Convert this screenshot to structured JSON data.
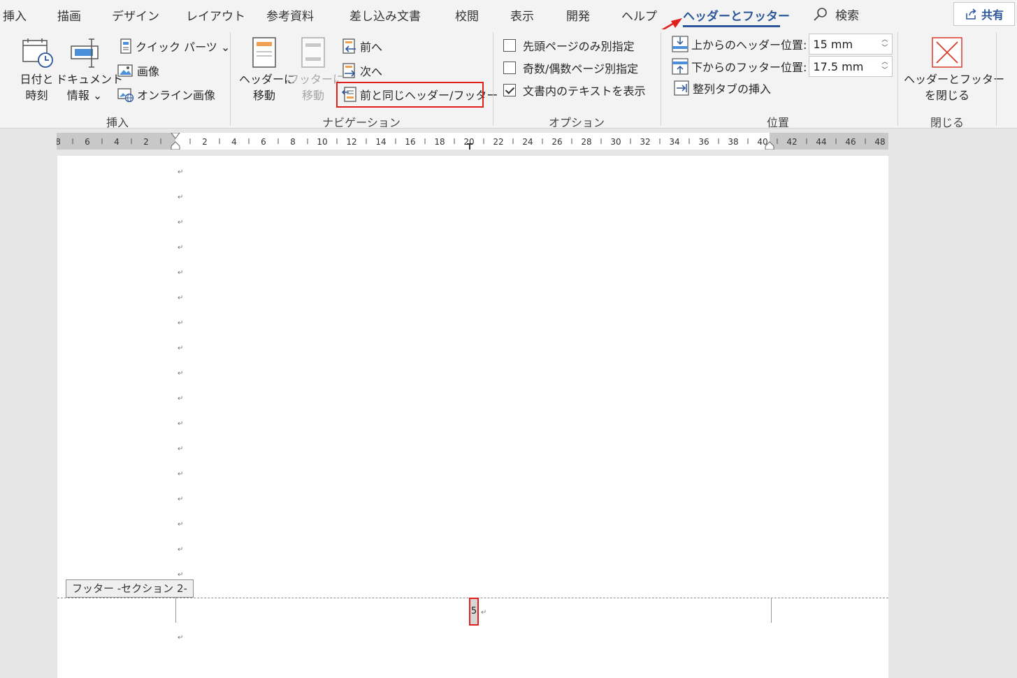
{
  "tabs": {
    "insert": "挿入",
    "draw": "描画",
    "design": "デザイン",
    "layout": "レイアウト",
    "references": "参考資料",
    "mailings": "差し込み文書",
    "review": "校閲",
    "view": "表示",
    "developer": "開発",
    "help": "ヘルプ",
    "header_footer": "ヘッダーとフッター",
    "search": "検索",
    "share": "共有"
  },
  "ribbon": {
    "insert_group": {
      "label": "挿入",
      "date_time_1": "日付と",
      "date_time_2": "時刻",
      "doc_info_1": "ドキュメント",
      "doc_info_2": "情報 ⌄",
      "quick_parts": "クイック パーツ ⌄",
      "image": "画像",
      "online_image": "オンライン画像"
    },
    "navigation_group": {
      "label": "ナビゲーション",
      "goto_header_1": "ヘッダーに",
      "goto_header_2": "移動",
      "goto_footer_1": "フッターに",
      "goto_footer_2": "移動",
      "previous": "前へ",
      "next": "次へ",
      "link_previous": "前と同じヘッダー/フッター"
    },
    "options_group": {
      "label": "オプション",
      "first_page": "先頭ページのみ別指定",
      "odd_even": "奇数/偶数ページ別指定",
      "show_doc_text": "文書内のテキストを表示",
      "first_page_checked": false,
      "odd_even_checked": false,
      "show_doc_text_checked": true
    },
    "position_group": {
      "label": "位置",
      "header_from_top": "上からのヘッダー位置:",
      "header_from_top_value": "15 mm",
      "footer_from_bottom": "下からのフッター位置:",
      "footer_from_bottom_value": "17.5 mm",
      "insert_alignment_tab": "整列タブの挿入"
    },
    "close_group": {
      "label": "閉じる",
      "close_1": "ヘッダーとフッター",
      "close_2": "を閉じる"
    }
  },
  "ruler": {
    "labels": [
      "8",
      "6",
      "4",
      "2",
      "2",
      "4",
      "6",
      "8",
      "10",
      "12",
      "14",
      "16",
      "18",
      "20",
      "22",
      "24",
      "26",
      "28",
      "30",
      "32",
      "34",
      "36",
      "38",
      "40",
      "42",
      "44",
      "46",
      "48"
    ]
  },
  "document": {
    "para_mark": "↵",
    "footer_label": "フッター -セクション 2-",
    "page_number": "5"
  },
  "colors": {
    "accent": "#2b579a",
    "highlight": "#e0201b"
  }
}
